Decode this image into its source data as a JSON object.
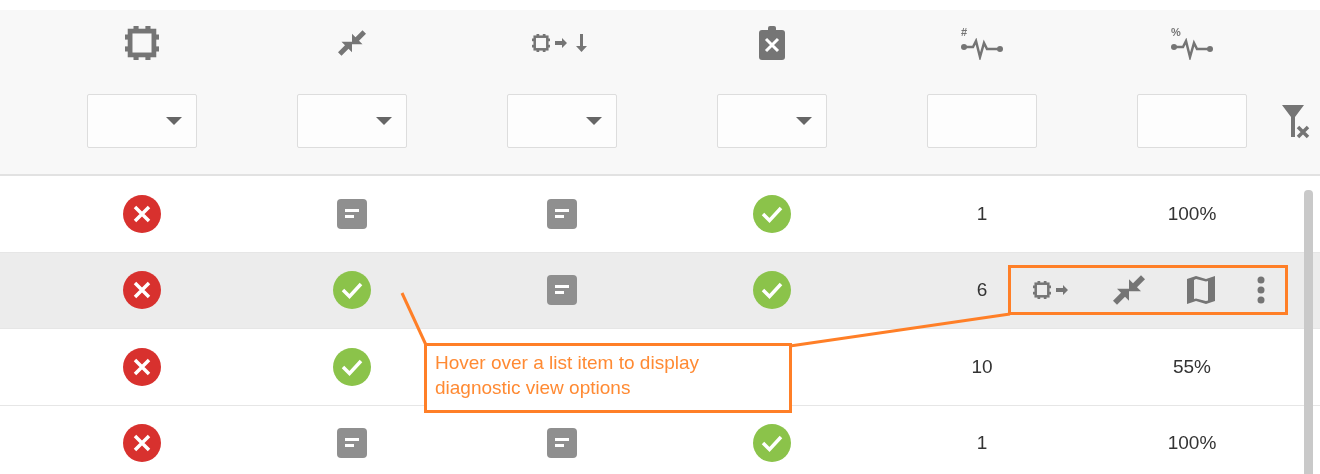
{
  "columns": [
    {
      "kind": "dropdown"
    },
    {
      "kind": "dropdown"
    },
    {
      "kind": "dropdown"
    },
    {
      "kind": "dropdown"
    },
    {
      "kind": "text",
      "mark": "#"
    },
    {
      "kind": "text",
      "mark": "%"
    }
  ],
  "rows": [
    {
      "hovered": false,
      "cells": [
        {
          "kind": "error"
        },
        {
          "kind": "note"
        },
        {
          "kind": "note"
        },
        {
          "kind": "ok"
        },
        {
          "kind": "text",
          "text": "1"
        },
        {
          "kind": "text",
          "text": "100%"
        }
      ]
    },
    {
      "hovered": true,
      "cells": [
        {
          "kind": "error"
        },
        {
          "kind": "ok"
        },
        {
          "kind": "note"
        },
        {
          "kind": "ok"
        },
        {
          "kind": "text",
          "text": "6"
        },
        {
          "kind": "covered"
        }
      ]
    },
    {
      "hovered": false,
      "cells": [
        {
          "kind": "error"
        },
        {
          "kind": "ok"
        },
        {
          "kind": "covered"
        },
        {
          "kind": "covered"
        },
        {
          "kind": "text",
          "text": "10"
        },
        {
          "kind": "text",
          "text": "55%"
        }
      ]
    },
    {
      "hovered": false,
      "cells": [
        {
          "kind": "error"
        },
        {
          "kind": "note"
        },
        {
          "kind": "note"
        },
        {
          "kind": "ok"
        },
        {
          "kind": "text",
          "text": "1"
        },
        {
          "kind": "text",
          "text": "100%"
        }
      ]
    }
  ],
  "callout": {
    "text": "Hover over a list item to display diagnostic view options"
  }
}
